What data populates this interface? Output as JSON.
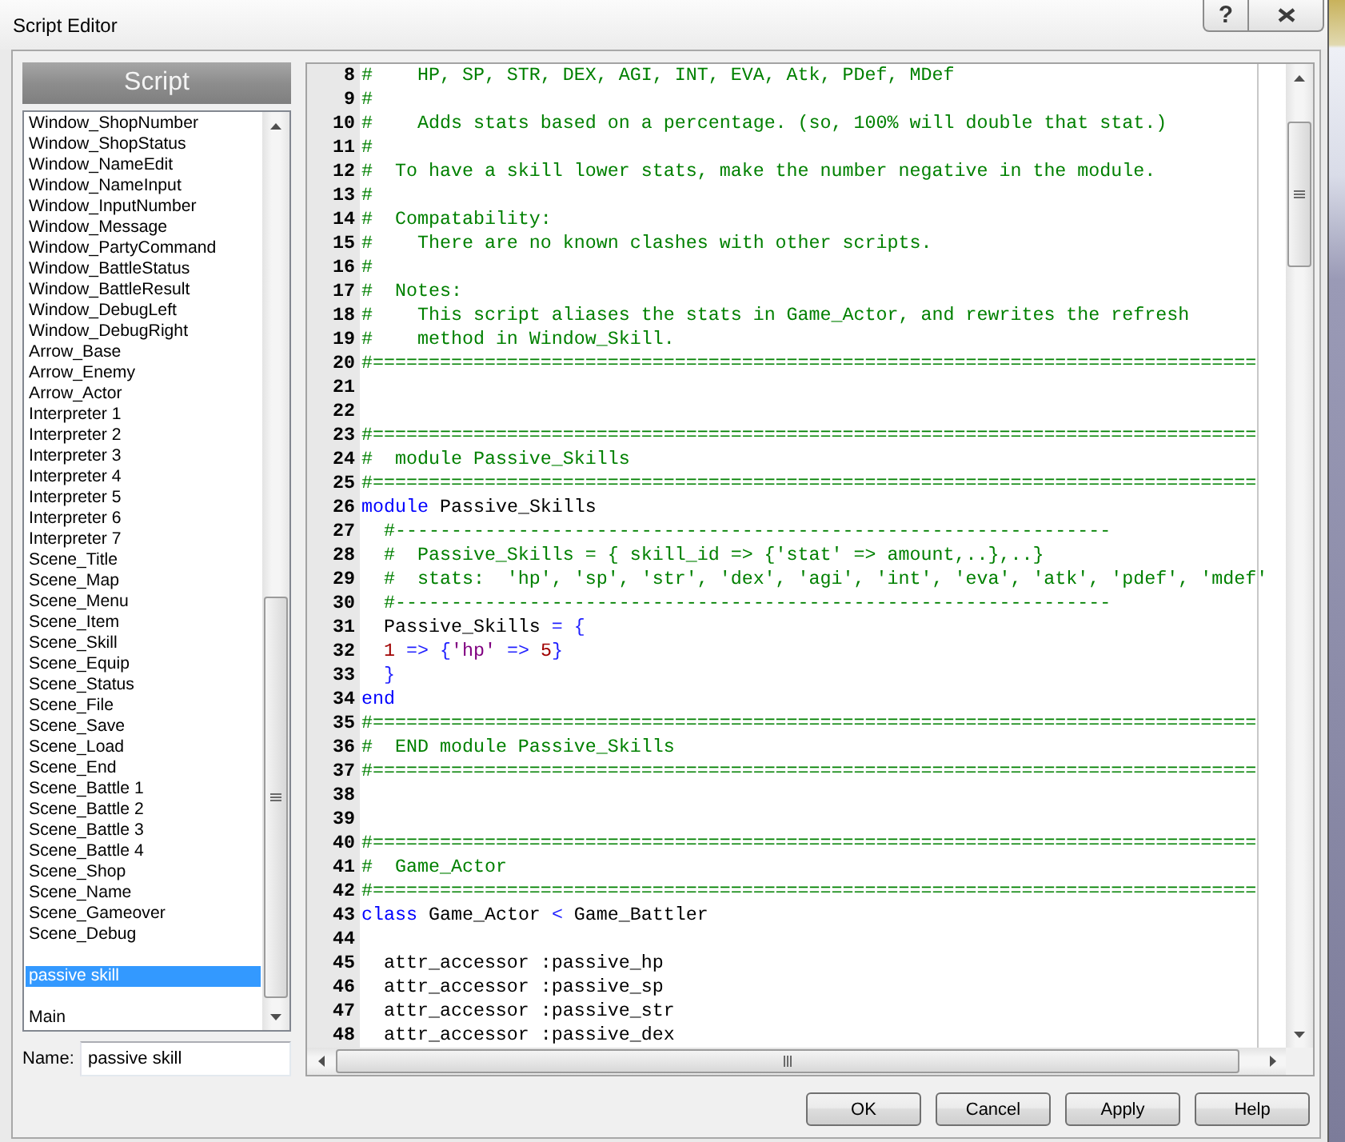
{
  "window": {
    "title": "Script Editor",
    "help_button": "?"
  },
  "script_list": {
    "header": "Script",
    "items": [
      {
        "kind": "script",
        "label": "Window_ShopNumber",
        "selected": false
      },
      {
        "kind": "script",
        "label": "Window_ShopStatus",
        "selected": false
      },
      {
        "kind": "script",
        "label": "Window_NameEdit",
        "selected": false
      },
      {
        "kind": "script",
        "label": "Window_NameInput",
        "selected": false
      },
      {
        "kind": "script",
        "label": "Window_InputNumber",
        "selected": false
      },
      {
        "kind": "script",
        "label": "Window_Message",
        "selected": false
      },
      {
        "kind": "script",
        "label": "Window_PartyCommand",
        "selected": false
      },
      {
        "kind": "script",
        "label": "Window_BattleStatus",
        "selected": false
      },
      {
        "kind": "script",
        "label": "Window_BattleResult",
        "selected": false
      },
      {
        "kind": "script",
        "label": "Window_DebugLeft",
        "selected": false
      },
      {
        "kind": "script",
        "label": "Window_DebugRight",
        "selected": false
      },
      {
        "kind": "script",
        "label": "Arrow_Base",
        "selected": false
      },
      {
        "kind": "script",
        "label": "Arrow_Enemy",
        "selected": false
      },
      {
        "kind": "script",
        "label": "Arrow_Actor",
        "selected": false
      },
      {
        "kind": "script",
        "label": "Interpreter 1",
        "selected": false
      },
      {
        "kind": "script",
        "label": "Interpreter 2",
        "selected": false
      },
      {
        "kind": "script",
        "label": "Interpreter 3",
        "selected": false
      },
      {
        "kind": "script",
        "label": "Interpreter 4",
        "selected": false
      },
      {
        "kind": "script",
        "label": "Interpreter 5",
        "selected": false
      },
      {
        "kind": "script",
        "label": "Interpreter 6",
        "selected": false
      },
      {
        "kind": "script",
        "label": "Interpreter 7",
        "selected": false
      },
      {
        "kind": "script",
        "label": "Scene_Title",
        "selected": false
      },
      {
        "kind": "script",
        "label": "Scene_Map",
        "selected": false
      },
      {
        "kind": "script",
        "label": "Scene_Menu",
        "selected": false
      },
      {
        "kind": "script",
        "label": "Scene_Item",
        "selected": false
      },
      {
        "kind": "script",
        "label": "Scene_Skill",
        "selected": false
      },
      {
        "kind": "script",
        "label": "Scene_Equip",
        "selected": false
      },
      {
        "kind": "script",
        "label": "Scene_Status",
        "selected": false
      },
      {
        "kind": "script",
        "label": "Scene_File",
        "selected": false
      },
      {
        "kind": "script",
        "label": "Scene_Save",
        "selected": false
      },
      {
        "kind": "script",
        "label": "Scene_Load",
        "selected": false
      },
      {
        "kind": "script",
        "label": "Scene_End",
        "selected": false
      },
      {
        "kind": "script",
        "label": "Scene_Battle 1",
        "selected": false
      },
      {
        "kind": "script",
        "label": "Scene_Battle 2",
        "selected": false
      },
      {
        "kind": "script",
        "label": "Scene_Battle 3",
        "selected": false
      },
      {
        "kind": "script",
        "label": "Scene_Battle 4",
        "selected": false
      },
      {
        "kind": "script",
        "label": "Scene_Shop",
        "selected": false
      },
      {
        "kind": "script",
        "label": "Scene_Name",
        "selected": false
      },
      {
        "kind": "script",
        "label": "Scene_Gameover",
        "selected": false
      },
      {
        "kind": "script",
        "label": "Scene_Debug",
        "selected": false
      },
      {
        "kind": "blank",
        "selected": false
      },
      {
        "kind": "script",
        "label": "passive skill",
        "selected": true
      },
      {
        "kind": "blank",
        "selected": false
      },
      {
        "kind": "script",
        "label": "Main",
        "selected": false
      }
    ]
  },
  "name_field": {
    "label": "Name:",
    "value": "passive skill"
  },
  "editor": {
    "lines": [
      {
        "number": "8",
        "code": [
          {
            "kind": "comment",
            "text": "#    HP, SP, STR, DEX, AGI, INT, EVA, Atk, PDef, MDef"
          }
        ]
      },
      {
        "number": "9",
        "code": [
          {
            "kind": "comment",
            "text": "#"
          }
        ]
      },
      {
        "number": "10",
        "code": [
          {
            "kind": "comment",
            "text": "#    Adds stats based on a percentage. (so, 100% will double that stat.)"
          }
        ]
      },
      {
        "number": "11",
        "code": [
          {
            "kind": "comment",
            "text": "#"
          }
        ]
      },
      {
        "number": "12",
        "code": [
          {
            "kind": "comment",
            "text": "#  To have a skill lower stats, make the number negative in the module."
          }
        ]
      },
      {
        "number": "13",
        "code": [
          {
            "kind": "comment",
            "text": "#"
          }
        ]
      },
      {
        "number": "14",
        "code": [
          {
            "kind": "comment",
            "text": "#  Compatability:"
          }
        ]
      },
      {
        "number": "15",
        "code": [
          {
            "kind": "comment",
            "text": "#    There are no known clashes with other scripts."
          }
        ]
      },
      {
        "number": "16",
        "code": [
          {
            "kind": "comment",
            "text": "#"
          }
        ]
      },
      {
        "number": "17",
        "code": [
          {
            "kind": "comment",
            "text": "#  Notes:"
          }
        ]
      },
      {
        "number": "18",
        "code": [
          {
            "kind": "comment",
            "text": "#    This script aliases the stats in Game_Actor, and rewrites the refresh"
          }
        ]
      },
      {
        "number": "19",
        "code": [
          {
            "kind": "comment",
            "text": "#    method in Window_Skill."
          }
        ]
      },
      {
        "number": "20",
        "code": [
          {
            "kind": "comment",
            "text": "#==============================================================================="
          }
        ]
      },
      {
        "number": "21"
      },
      {
        "number": "22"
      },
      {
        "number": "23",
        "code": [
          {
            "kind": "comment",
            "text": "#==============================================================================="
          }
        ]
      },
      {
        "number": "24",
        "code": [
          {
            "kind": "comment",
            "text": "#  module Passive_Skills"
          }
        ]
      },
      {
        "number": "25",
        "code": [
          {
            "kind": "comment",
            "text": "#==============================================================================="
          }
        ]
      },
      {
        "number": "26",
        "code": [
          {
            "kind": "keyword",
            "text": "module"
          },
          {
            "kind": "plain",
            "text": " Passive_Skills"
          }
        ]
      },
      {
        "number": "27",
        "code": [
          {
            "kind": "comment",
            "text": "  #----------------------------------------------------------------"
          }
        ]
      },
      {
        "number": "28",
        "code": [
          {
            "kind": "comment",
            "text": "  #  Passive_Skills = { skill_id => {'stat' => amount,..},..}"
          }
        ]
      },
      {
        "number": "29",
        "code": [
          {
            "kind": "comment",
            "text": "  #  stats:  'hp', 'sp', 'str', 'dex', 'agi', 'int', 'eva', 'atk', 'pdef', 'mdef'"
          }
        ]
      },
      {
        "number": "30",
        "code": [
          {
            "kind": "comment",
            "text": "  #----------------------------------------------------------------"
          }
        ]
      },
      {
        "number": "31",
        "code": [
          {
            "kind": "plain",
            "text": "  Passive_Skills "
          },
          {
            "kind": "operator",
            "text": "= {"
          }
        ]
      },
      {
        "number": "32",
        "code": [
          {
            "kind": "number",
            "text": "  1"
          },
          {
            "kind": "operator",
            "text": " => {"
          },
          {
            "kind": "string",
            "text": "'hp'"
          },
          {
            "kind": "operator",
            "text": " => "
          },
          {
            "kind": "number",
            "text": "5"
          },
          {
            "kind": "operator",
            "text": "}"
          }
        ]
      },
      {
        "number": "33",
        "code": [
          {
            "kind": "operator",
            "text": "  }"
          }
        ]
      },
      {
        "number": "34",
        "code": [
          {
            "kind": "keyword",
            "text": "end"
          }
        ]
      },
      {
        "number": "35",
        "code": [
          {
            "kind": "comment",
            "text": "#==============================================================================="
          }
        ]
      },
      {
        "number": "36",
        "code": [
          {
            "kind": "comment",
            "text": "#  END module Passive_Skills"
          }
        ]
      },
      {
        "number": "37",
        "code": [
          {
            "kind": "comment",
            "text": "#==============================================================================="
          }
        ]
      },
      {
        "number": "38"
      },
      {
        "number": "39"
      },
      {
        "number": "40",
        "code": [
          {
            "kind": "comment",
            "text": "#==============================================================================="
          }
        ]
      },
      {
        "number": "41",
        "code": [
          {
            "kind": "comment",
            "text": "#  Game_Actor"
          }
        ]
      },
      {
        "number": "42",
        "code": [
          {
            "kind": "comment",
            "text": "#==============================================================================="
          }
        ]
      },
      {
        "number": "43",
        "code": [
          {
            "kind": "keyword",
            "text": "class"
          },
          {
            "kind": "plain",
            "text": " Game_Actor "
          },
          {
            "kind": "operator",
            "text": "<"
          },
          {
            "kind": "plain",
            "text": " Game_Battler"
          }
        ]
      },
      {
        "number": "44"
      },
      {
        "number": "45",
        "code": [
          {
            "kind": "plain",
            "text": "  attr_accessor :passive_hp"
          }
        ]
      },
      {
        "number": "46",
        "code": [
          {
            "kind": "plain",
            "text": "  attr_accessor :passive_sp"
          }
        ]
      },
      {
        "number": "47",
        "code": [
          {
            "kind": "plain",
            "text": "  attr_accessor :passive_str"
          }
        ]
      },
      {
        "number": "48",
        "code": [
          {
            "kind": "plain",
            "text": "  attr_accessor :passive_dex"
          }
        ]
      }
    ]
  },
  "buttons": [
    "OK",
    "Cancel",
    "Apply",
    "Help"
  ]
}
